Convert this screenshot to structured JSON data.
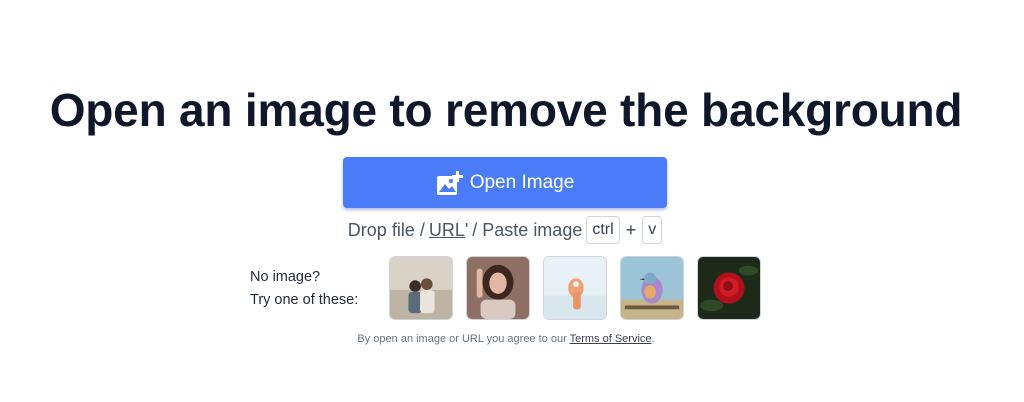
{
  "heading": "Open an image to remove the background",
  "open_button": {
    "label": "Open Image",
    "icon": "add-image-icon"
  },
  "drop_row": {
    "prefix": "Drop file /",
    "url_label": "URL",
    "url_tick": "'",
    "paste_label": "/ Paste image",
    "key_ctrl": "ctrl",
    "plus": "+",
    "key_v": "v"
  },
  "samples": {
    "label_line1": "No image?",
    "label_line2": "Try one of these:",
    "items": [
      {
        "name": "couple-sample"
      },
      {
        "name": "woman-sample"
      },
      {
        "name": "hand-sample"
      },
      {
        "name": "bird-sample"
      },
      {
        "name": "rose-sample"
      }
    ]
  },
  "terms": {
    "text": "By open an image or URL you agree to our",
    "link_label": "Terms of Service",
    "suffix": "."
  },
  "colors": {
    "primary": "#4a7cf7",
    "heading": "#0f172a",
    "muted_text": "#4b5563"
  }
}
